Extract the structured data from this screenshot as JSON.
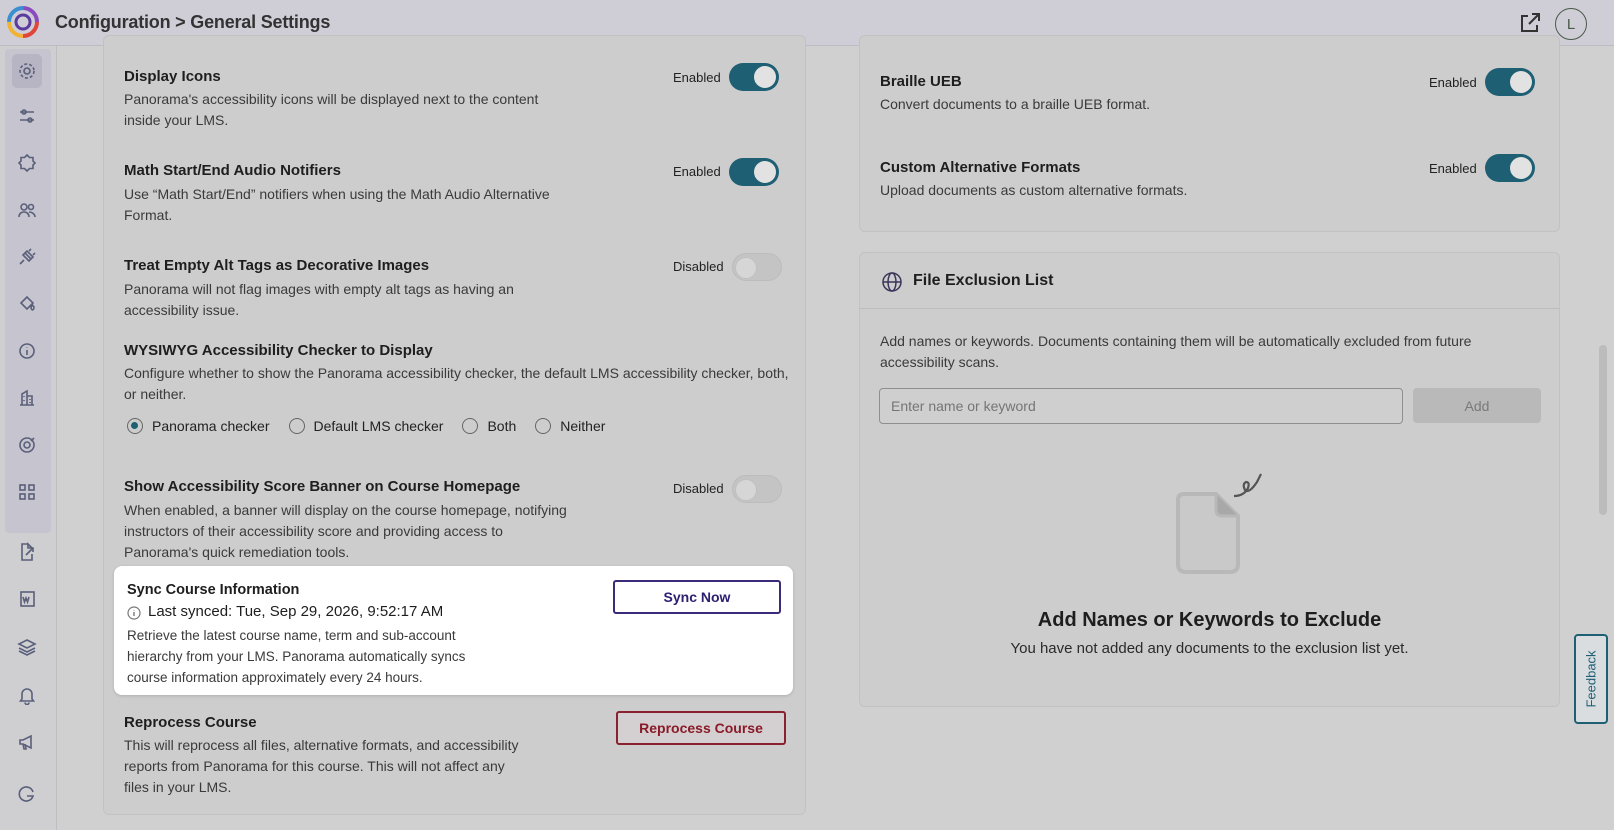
{
  "header": {
    "breadcrumb": "Configuration > General Settings",
    "avatar_initial": "L",
    "accent": "#1f5f74"
  },
  "sidebar": {
    "icons": [
      "gear-icon",
      "sliders-icon",
      "badge-icon",
      "users-icon",
      "plug-icon",
      "paint-bucket-icon",
      "info-icon",
      "building-icon",
      "target-icon",
      "grid-icon",
      "file-export-icon",
      "word-doc-icon",
      "layers-icon",
      "bell-icon",
      "megaphone-icon",
      "g-logo-icon"
    ]
  },
  "left": {
    "display_icons": {
      "title": "Display Icons",
      "desc": "Panorama's accessibility icons will be displayed next to the content inside your LMS.",
      "state": "Enabled"
    },
    "math_notifiers": {
      "title": "Math Start/End Audio Notifiers",
      "desc": "Use “Math Start/End” notifiers when using the Math Audio Alternative Format.",
      "state": "Enabled"
    },
    "empty_alt": {
      "title": "Treat Empty Alt Tags as Decorative Images",
      "desc": "Panorama will not flag images with empty alt tags as having an accessibility issue.",
      "state": "Disabled"
    },
    "wysiwyg": {
      "title": "WYSIWYG Accessibility Checker to Display",
      "desc": "Configure whether to show the Panorama accessibility checker, the default LMS accessibility checker, both, or neither.",
      "options": [
        "Panorama checker",
        "Default LMS checker",
        "Both",
        "Neither"
      ],
      "selected": "Panorama checker"
    },
    "score_banner": {
      "title": "Show Accessibility Score Banner on Course Homepage",
      "desc": "When enabled, a banner will display on the course homepage, notifying instructors of their accessibility score and providing access to Panorama's quick remediation tools.",
      "state": "Disabled"
    },
    "sync": {
      "title": "Sync Course Information",
      "last_synced": "Last synced: Tue, Sep 29, 2026, 9:52:17 AM",
      "desc": "Retrieve the latest course name, term and sub-account hierarchy from your LMS. Panorama automatically syncs course information approximately every 24 hours.",
      "button": "Sync Now"
    },
    "reprocess": {
      "title": "Reprocess Course",
      "desc": "This will reprocess all files, alternative formats, and accessibility reports from Panorama for this course. This will not affect any files in your LMS.",
      "button": "Reprocess Course"
    }
  },
  "right": {
    "braille": {
      "title": "Braille UEB",
      "desc": "Convert documents to a braille UEB format.",
      "state": "Enabled"
    },
    "custom_formats": {
      "title": "Custom Alternative Formats",
      "desc": "Upload documents as custom alternative formats.",
      "state": "Enabled"
    },
    "exclusion": {
      "title": "File Exclusion List",
      "desc": "Add names or keywords. Documents containing them will be automatically excluded from future accessibility scans.",
      "placeholder": "Enter name or keyword",
      "add_button": "Add",
      "empty_title": "Add Names or Keywords to Exclude",
      "empty_sub": "You have not added any documents to the exclusion list yet."
    }
  },
  "feedback": "Feedback"
}
